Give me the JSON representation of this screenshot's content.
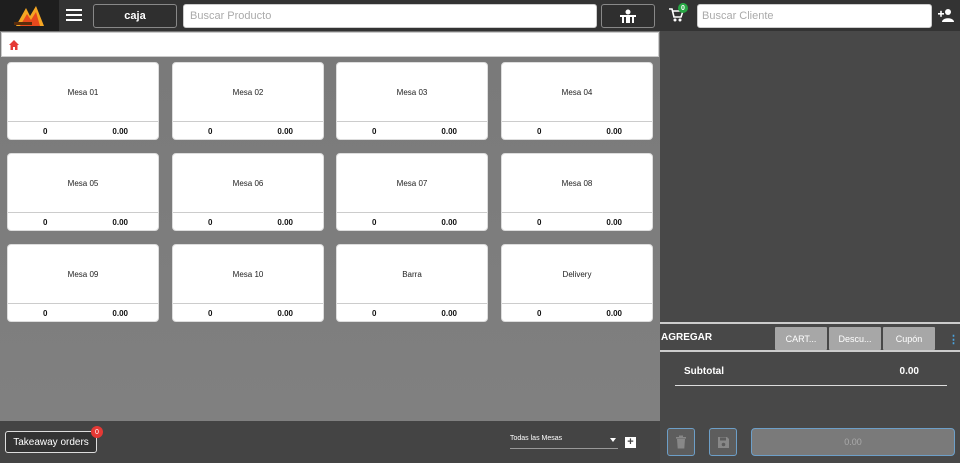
{
  "header": {
    "caja_label": "caja",
    "search_product_placeholder": "Buscar Producto",
    "cart_count": "0",
    "search_client_placeholder": "Buscar Cliente"
  },
  "mesas": [
    {
      "name": "Mesa 01",
      "count": "0",
      "total": "0.00"
    },
    {
      "name": "Mesa 02",
      "count": "0",
      "total": "0.00"
    },
    {
      "name": "Mesa 03",
      "count": "0",
      "total": "0.00"
    },
    {
      "name": "Mesa 04",
      "count": "0",
      "total": "0.00"
    },
    {
      "name": "Mesa 05",
      "count": "0",
      "total": "0.00"
    },
    {
      "name": "Mesa 06",
      "count": "0",
      "total": "0.00"
    },
    {
      "name": "Mesa 07",
      "count": "0",
      "total": "0.00"
    },
    {
      "name": "Mesa 08",
      "count": "0",
      "total": "0.00"
    },
    {
      "name": "Mesa 09",
      "count": "0",
      "total": "0.00"
    },
    {
      "name": "Mesa 10",
      "count": "0",
      "total": "0.00"
    },
    {
      "name": "Barra",
      "count": "0",
      "total": "0.00"
    },
    {
      "name": "Delivery",
      "count": "0",
      "total": "0.00"
    }
  ],
  "bottom": {
    "takeaway_label": "Takeaway orders",
    "takeaway_count": "0",
    "mesas_filter": "Todas las Mesas"
  },
  "order": {
    "agregar_label": "AGREGAR",
    "chips": [
      "CART...",
      "Descu...",
      "Cupón"
    ],
    "subtotal_label": "Subtotal",
    "subtotal_value": "0.00",
    "total_button": "0.00"
  },
  "colors": {
    "topbar": "#333333",
    "panel": "#484848",
    "accent_blue": "#4aa3df",
    "badge_red": "#e53935",
    "badge_green": "#28a745",
    "home_red": "#e53935"
  }
}
